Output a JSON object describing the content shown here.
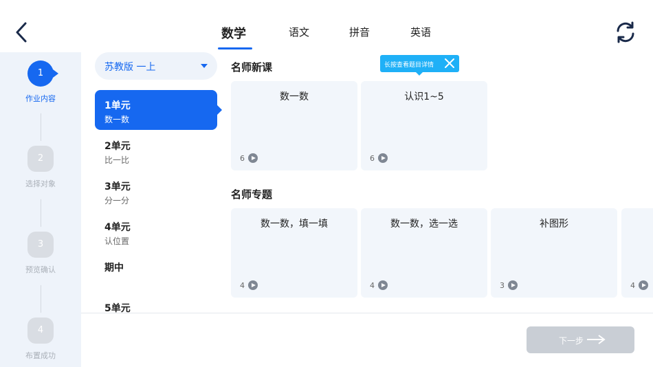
{
  "tabs": [
    {
      "label": "数学",
      "active": true
    },
    {
      "label": "语文",
      "active": false
    },
    {
      "label": "拼音",
      "active": false
    },
    {
      "label": "英语",
      "active": false
    }
  ],
  "stepper": [
    {
      "number": "1",
      "label": "作业内容",
      "active": true
    },
    {
      "number": "2",
      "label": "选择对象",
      "active": false
    },
    {
      "number": "3",
      "label": "预览确认",
      "active": false
    },
    {
      "number": "4",
      "label": "布置成功",
      "active": false
    }
  ],
  "version_select": {
    "value": "苏教版 一上"
  },
  "units": [
    {
      "title": "1单元",
      "subtitle": "数一数",
      "active": true
    },
    {
      "title": "2单元",
      "subtitle": "比一比",
      "active": false
    },
    {
      "title": "3单元",
      "subtitle": "分一分",
      "active": false
    },
    {
      "title": "4单元",
      "subtitle": "认位置",
      "active": false
    },
    {
      "title": "期中",
      "subtitle": "",
      "active": false
    },
    {
      "title": "5单元",
      "subtitle": "",
      "active": false
    }
  ],
  "sections": [
    {
      "title": "名师新课",
      "cards": [
        {
          "title": "数一数",
          "count": "6"
        },
        {
          "title": "认识1~5",
          "count": "6"
        }
      ]
    },
    {
      "title": "名师专题",
      "cards": [
        {
          "title": "数一数，填一填",
          "count": "4"
        },
        {
          "title": "数一数，选一选",
          "count": "4"
        },
        {
          "title": "补图形",
          "count": "3"
        },
        {
          "title": "",
          "count": "4"
        }
      ]
    }
  ],
  "tooltip": {
    "text": "长按查看题目详情"
  },
  "next_button": {
    "label": "下一步"
  },
  "colors": {
    "accent": "#1668f0",
    "tooltip": "#1fb0f7",
    "disabled": "#c9ced5",
    "sidebar_bg": "#eef3fa"
  }
}
